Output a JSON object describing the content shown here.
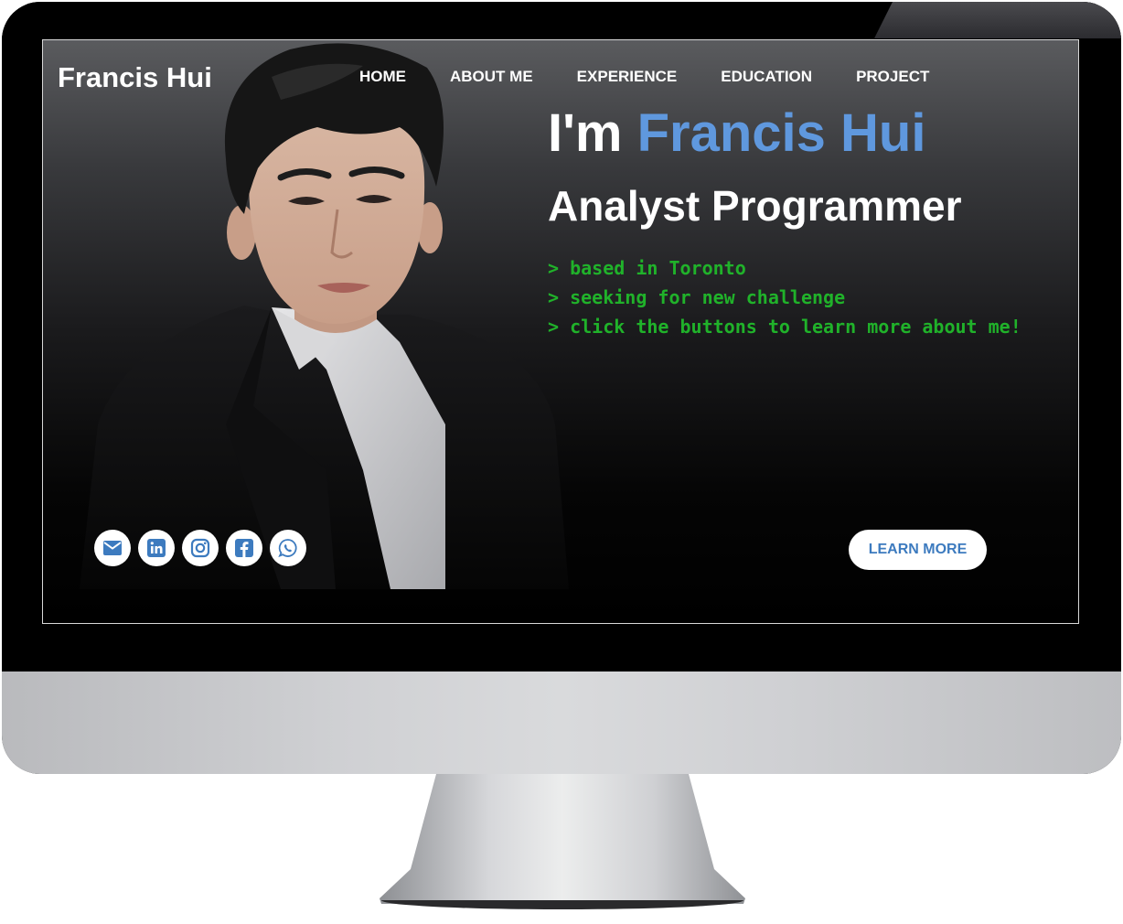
{
  "site": {
    "brand": "Francis Hui"
  },
  "nav": {
    "items": [
      {
        "label": "HOME"
      },
      {
        "label": "ABOUT ME"
      },
      {
        "label": "EXPERIENCE"
      },
      {
        "label": "EDUCATION"
      },
      {
        "label": "PROJECT"
      }
    ]
  },
  "hero": {
    "greeting": "I'm ",
    "name": "Francis Hui",
    "role": "Analyst Programmer",
    "lines": [
      "> based in Toronto",
      "> seeking for new challenge",
      "> click the buttons to learn more about me!"
    ],
    "cta_label": "LEARN MORE"
  },
  "social": {
    "icons": [
      "email-icon",
      "linkedin-icon",
      "instagram-icon",
      "facebook-icon",
      "whatsapp-icon"
    ]
  },
  "colors": {
    "accent": "#5f98de",
    "terminal_green": "#20b22a",
    "button_text": "#3d7bbf",
    "icon_blue": "#3d7bbf"
  }
}
